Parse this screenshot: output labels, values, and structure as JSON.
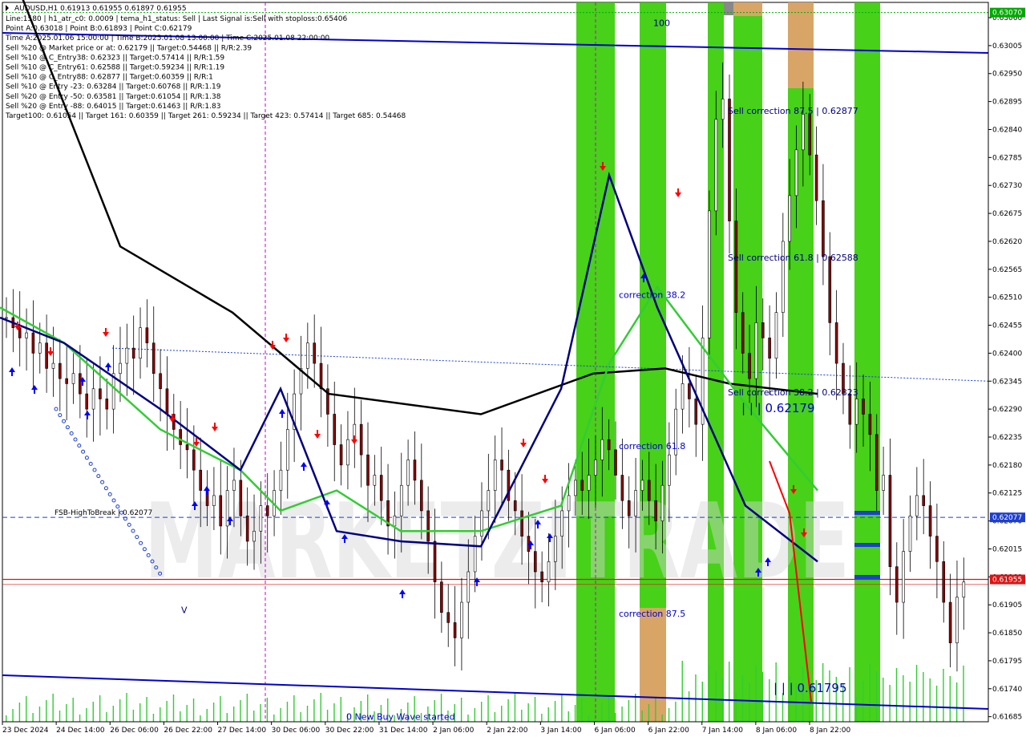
{
  "chart_data": {
    "type": "candlestick",
    "symbol_line": "AUDUSD,H1  0.61913 0.61955 0.61897 0.61955",
    "info_lines": [
      "Line:1580 | h1_atr_c0: 0.0009 | tema_h1_status: Sell | Last Signal is:Sell with stoploss:0.65406",
      "Point A:0.63018 | Point B:0.61893 | Point C:0.62179",
      "Time A:2025.01.06 15:00:00 | Time B:2025.01.08 13:00:00 | Time C:2025.01.08 22:00:00",
      "Sell %20 @ Market price or at: 0.62179 || Target:0.54468 || R/R:2.39",
      "Sell %10 @ C_Entry38: 0.62323 || Target:0.57414 || R/R:1.59",
      "Sell %10 @ C_Entry61: 0.62588 || Target:0.59234 || R/R:1.19",
      "Sell %10 @ C_Entry88: 0.62877 || Target:0.60359 || R/R:1",
      "Sell %10 @ Entry -23: 0.63284 || Target:0.60768 || R/R:1.19",
      "Sell %20 @ Entry -50: 0.63581 || Target:0.61054 || R/R:1.38",
      "Sell %20 @ Entry -88: 0.64015 || Target:0.61463 || R/R:1.83",
      "Target100: 0.61054 || Target 161: 0.60359 || Target 261: 0.59234 || Target 423: 0.57414 || Target 685: 0.54468"
    ],
    "y_ticks": [
      "0.63060",
      "0.63005",
      "0.62950",
      "0.62895",
      "0.62840",
      "0.62785",
      "0.62730",
      "0.62675",
      "0.62620",
      "0.62565",
      "0.62510",
      "0.62455",
      "0.62400",
      "0.62345",
      "0.62290",
      "0.62235",
      "0.62180",
      "0.62125",
      "0.62070",
      "0.62015",
      "0.61960",
      "0.61905",
      "0.61850",
      "0.61795",
      "0.61740",
      "0.61685"
    ],
    "y_range": [
      0.61675,
      0.6309
    ],
    "x_labels": [
      "23 Dec 2024",
      "24 Dec 14:00",
      "26 Dec 06:00",
      "26 Dec 22:00",
      "27 Dec 14:00",
      "30 Dec 06:00",
      "30 Dec 22:00",
      "31 Dec 14:00",
      "2 Jan 06:00",
      "2 Jan 22:00",
      "3 Jan 14:00",
      "6 Jan 06:00",
      "6 Jan 22:00",
      "7 Jan 14:00",
      "8 Jan 06:00",
      "8 Jan 22:00"
    ],
    "price_tags": [
      {
        "label": "0.63070",
        "price": 0.6307,
        "color": "#00aa00"
      },
      {
        "label": "0.62077",
        "price": 0.62077,
        "color": "#1e3fcf"
      },
      {
        "label": "0.61955",
        "price": 0.61955,
        "color": "#dc1414"
      }
    ],
    "levels": [
      {
        "name": "FSB-HighToBreak",
        "label": "FSB-HighToBreak  |  0.62077",
        "price": 0.62077
      },
      {
        "name": "last-price",
        "price": 0.61955
      }
    ],
    "annotations": [
      {
        "text": "100",
        "price": 0.6305
      },
      {
        "text": "Sell correction 87.5 | 0.62877",
        "price": 0.62877
      },
      {
        "text": "Sell correction 61.8 | 0.62588",
        "price": 0.62588
      },
      {
        "text": "Sell correction 38.2 | 0.62323",
        "price": 0.62323
      },
      {
        "text": "correction 38.2",
        "price": 0.62515
      },
      {
        "text": "correction 61.8",
        "price": 0.62218
      },
      {
        "text": "correction 87.5",
        "price": 0.61888
      },
      {
        "text": "| | | 0.62179",
        "price": 0.6229
      },
      {
        "text": "| | | 0.61795",
        "price": 0.6174
      },
      {
        "text": "0 New Buy Wave started",
        "price": 0.61685
      },
      {
        "text": "V",
        "price": 0.61895
      }
    ],
    "watermark": "MARKETZITRADE",
    "close_series": [
      0.6247,
      0.6245,
      0.6243,
      0.6244,
      0.624,
      0.6242,
      0.6237,
      0.6238,
      0.6235,
      0.6234,
      0.6236,
      0.6232,
      0.6229,
      0.6233,
      0.6231,
      0.6229,
      0.6236,
      0.6238,
      0.6241,
      0.6239,
      0.6245,
      0.6242,
      0.6236,
      0.6233,
      0.6228,
      0.6225,
      0.6222,
      0.6221,
      0.6217,
      0.6213,
      0.621,
      0.6212,
      0.6206,
      0.6213,
      0.6215,
      0.6208,
      0.6203,
      0.6205,
      0.621,
      0.6208,
      0.6213,
      0.6217,
      0.6225,
      0.6232,
      0.6237,
      0.6242,
      0.6238,
      0.6233,
      0.6228,
      0.6222,
      0.6218,
      0.6223,
      0.6226,
      0.622,
      0.6214,
      0.6216,
      0.6211,
      0.6206,
      0.6208,
      0.6214,
      0.6219,
      0.6215,
      0.6209,
      0.6203,
      0.6195,
      0.6189,
      0.6187,
      0.6184,
      0.6191,
      0.6197,
      0.6204,
      0.6209,
      0.6213,
      0.6219,
      0.6217,
      0.6211,
      0.6209,
      0.6204,
      0.6201,
      0.6197,
      0.6195,
      0.6199,
      0.6204,
      0.6209,
      0.6212,
      0.6215,
      0.6213,
      0.6216,
      0.6219,
      0.6223,
      0.6221,
      0.6216,
      0.6211,
      0.6208,
      0.6213,
      0.6215,
      0.6211,
      0.6207,
      0.6214,
      0.622,
      0.6229,
      0.6234,
      0.6231,
      0.6226,
      0.6243,
      0.6268,
      0.6286,
      0.629,
      0.6266,
      0.6248,
      0.624,
      0.6235,
      0.6246,
      0.6243,
      0.6239,
      0.6248,
      0.6262,
      0.6271,
      0.628,
      0.6287,
      0.6279,
      0.627,
      0.6259,
      0.6246,
      0.6238,
      0.6232,
      0.6226,
      0.6231,
      0.6228,
      0.6224,
      0.6213,
      0.6216,
      0.6198,
      0.6191,
      0.6201,
      0.6208,
      0.6212,
      0.621,
      0.6204,
      0.6199,
      0.6191,
      0.6183,
      0.6192,
      0.6195
    ],
    "ma_200_black": [
      0.6321,
      0.6261,
      0.6248,
      0.6232,
      0.6228,
      0.6236,
      0.6237,
      0.6234,
      0.6232
    ],
    "ma_green": [
      0.6249,
      0.6242,
      0.6225,
      0.6217,
      0.6209,
      0.6213,
      0.6205,
      0.6205,
      0.621,
      0.6238,
      0.6253,
      0.623,
      0.6213
    ],
    "ma_navy": [
      0.6247,
      0.6242,
      0.6229,
      0.6217,
      0.6233,
      0.6205,
      0.6203,
      0.6202,
      0.6233,
      0.6275,
      0.6249,
      0.621,
      0.6199
    ],
    "channel_top": [
      0.6303,
      0.6298
    ],
    "channel_bottom": [
      0.61762,
      0.61708
    ],
    "zones": [
      {
        "color": "#33cc00",
        "opacity": 0.9
      },
      {
        "color": "#33cc00",
        "opacity": 0.9
      },
      {
        "color": "#33cc00",
        "opacity": 0.9
      },
      {
        "color": "#33cc00",
        "opacity": 0.9
      },
      {
        "color": "#33cc00",
        "opacity": 0.9
      },
      {
        "color": "#33cc00",
        "opacity": 0.9
      },
      {
        "color": "#e8a070",
        "opacity": 0.9
      },
      {
        "color": "#e8a070",
        "opacity": 0.9
      },
      {
        "color": "#e8a070",
        "opacity": 0.9
      }
    ],
    "colors": {
      "bull": "#000000",
      "bear": "#8b0000",
      "volume": "#33cc33",
      "sell_arrow": "#ff0000",
      "buy_arrow": "#0000ff",
      "channel": "#0000cd"
    }
  }
}
